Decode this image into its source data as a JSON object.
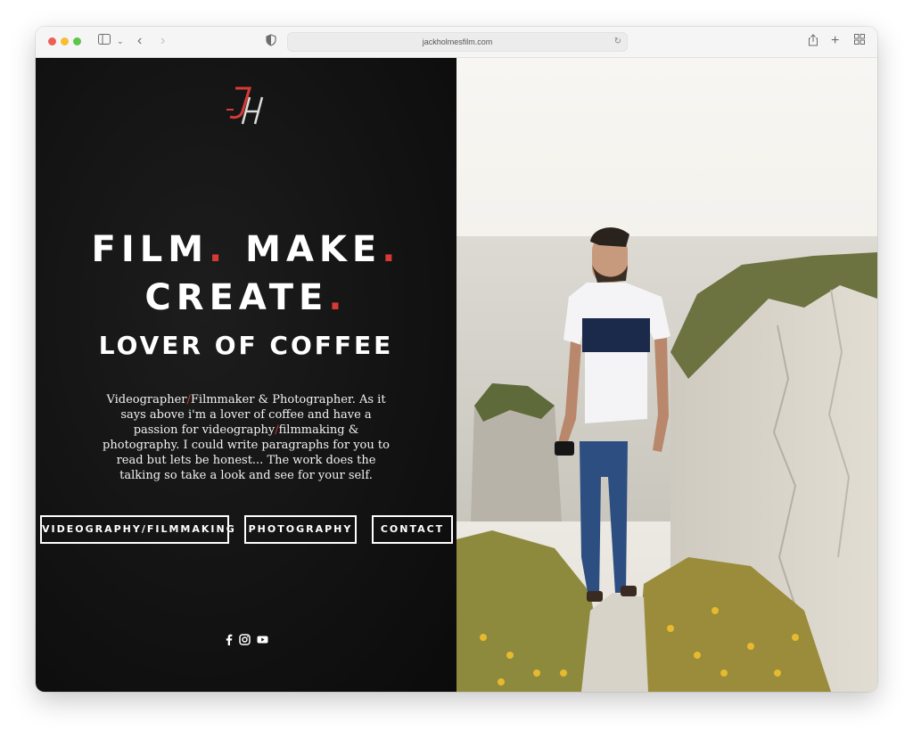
{
  "browser": {
    "url": "jackholmesfilm.com"
  },
  "hero": {
    "line1": [
      "FILM",
      ". ",
      "MAKE",
      "."
    ],
    "line2": [
      "CREATE",
      "."
    ],
    "line3": "LOVER OF COFFEE",
    "paragraph_parts": [
      "Videographer",
      "/",
      "Filmmaker & Photographer. As it says above i'm a lover of coffee and have a passion for videography",
      "/",
      "filmmaking  & photography. I could write paragraphs for you to read but lets be honest... The work does the talking so take a look and see for your self."
    ]
  },
  "nav": {
    "videography": "VIDEOGRAPHY/FILMMAKING",
    "photography": "PHOTOGRAPHY",
    "contact": "CONTACT"
  },
  "social": [
    "facebook-icon",
    "instagram-icon",
    "youtube-icon"
  ],
  "colors": {
    "accent": "#d63a35",
    "left_background": "#121212",
    "text": "#ffffff"
  }
}
